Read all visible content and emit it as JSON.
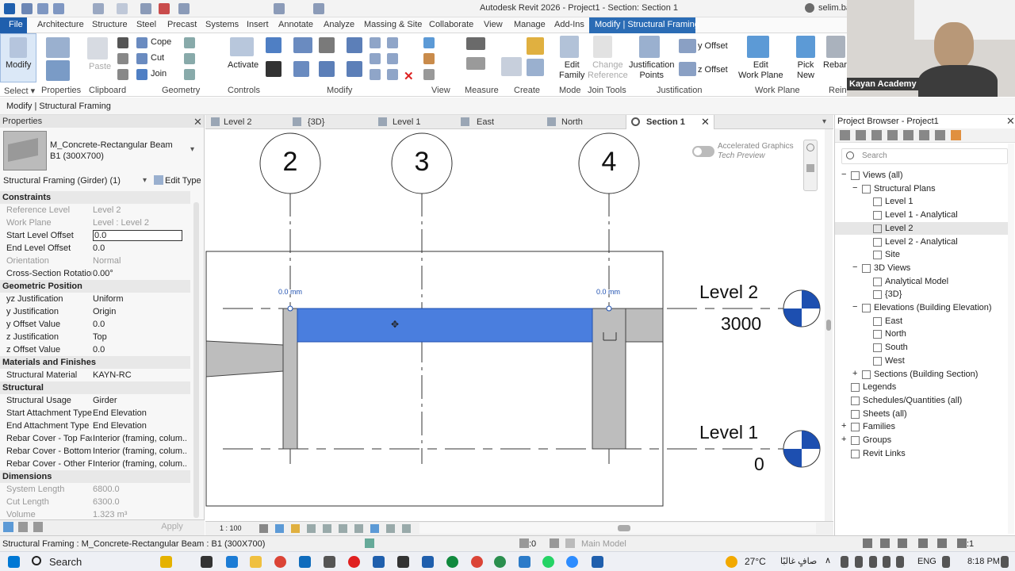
{
  "title": "Autodesk Revit 2026 - Project1 - Section: Section 1",
  "user": "selim.ba",
  "tabs": [
    "File",
    "Architecture",
    "Structure",
    "Steel",
    "Precast",
    "Systems",
    "Insert",
    "Annotate",
    "Analyze",
    "Massing & Site",
    "Collaborate",
    "View",
    "Manage",
    "Add-Ins",
    "Modify | Structural Framing"
  ],
  "ribbon": {
    "modify": "Modify",
    "paste": "Paste",
    "cope": "Cope",
    "cut": "Cut",
    "join": "Join",
    "activate": "Activate",
    "edit_family": "Edit\nFamily",
    "change_reference": "Change\nReference",
    "justification_points": "Justification\nPoints",
    "y_offset": "y Offset",
    "z_offset": "z Offset",
    "edit_work_plane": "Edit\nWork Plane",
    "pick_new": "Pick\nNew",
    "rebar": "Rebar",
    "panels": [
      "Select",
      "Properties",
      "Clipboard",
      "Geometry",
      "Controls",
      "Modify",
      "View",
      "Measure",
      "Create",
      "Mode",
      "Join Tools",
      "Justification",
      "Work Plane",
      "Rein"
    ]
  },
  "webcam_label": "Kayan Academy",
  "option_bar": "Modify | Structural Framing",
  "properties": {
    "title": "Properties",
    "family": "M_Concrete-Rectangular Beam",
    "type": "B1 (300X700)",
    "selector": "Structural Framing (Girder) (1)",
    "edit_type": "Edit Type",
    "sections": [
      {
        "name": "Constraints",
        "rows": [
          [
            "Reference Level",
            "Level 2",
            true
          ],
          [
            "Work Plane",
            "Level : Level 2",
            true
          ],
          [
            "Start Level Offset",
            "0.0",
            false
          ],
          [
            "End Level Offset",
            "0.0",
            false
          ],
          [
            "Orientation",
            "Normal",
            true
          ],
          [
            "Cross-Section Rotation",
            "0.00°",
            false
          ]
        ]
      },
      {
        "name": "Geometric Position",
        "rows": [
          [
            "yz Justification",
            "Uniform",
            false
          ],
          [
            "y Justification",
            "Origin",
            false
          ],
          [
            "y Offset Value",
            "0.0",
            false
          ],
          [
            "z Justification",
            "Top",
            false
          ],
          [
            "z Offset Value",
            "0.0",
            false
          ]
        ]
      },
      {
        "name": "Materials and Finishes",
        "rows": [
          [
            "Structural Material",
            "KAYN-RC",
            false
          ]
        ]
      },
      {
        "name": "Structural",
        "rows": [
          [
            "Structural Usage",
            "Girder",
            false
          ],
          [
            "Start Attachment Type",
            "End Elevation",
            false
          ],
          [
            "End Attachment Type",
            "End Elevation",
            false
          ],
          [
            "Rebar Cover - Top Face",
            "Interior (framing, colum...",
            false
          ],
          [
            "Rebar Cover - Bottom ...",
            "Interior (framing, colum...",
            false
          ],
          [
            "Rebar Cover - Other Fa...",
            "Interior (framing, colum...",
            false
          ]
        ]
      },
      {
        "name": "Dimensions",
        "rows": [
          [
            "System Length",
            "6800.0",
            true
          ],
          [
            "Cut Length",
            "6300.0",
            true
          ],
          [
            "Volume",
            "1.323 m³",
            true
          ]
        ]
      }
    ],
    "apply": "Apply"
  },
  "view_tabs": [
    "Level 2",
    "{3D}",
    "Level 1",
    "East",
    "North",
    "Section 1"
  ],
  "canvas": {
    "grids": [
      "2",
      "3",
      "4"
    ],
    "levels": [
      {
        "name": "Level 2",
        "elev": "3000"
      },
      {
        "name": "Level 1",
        "elev": "0"
      }
    ],
    "dim_left": "0.0 mm",
    "dim_right": "0.0 mm",
    "accel1": "Accelerated Graphics",
    "accel2": "Tech Preview",
    "scale": "1 : 100"
  },
  "browser": {
    "title": "Project Browser - Project1",
    "search": "Search",
    "nodes": [
      {
        "t": "Views (all)",
        "d": 0,
        "x": "−"
      },
      {
        "t": "Structural Plans",
        "d": 1,
        "x": "−"
      },
      {
        "t": "Level 1",
        "d": 2,
        "x": ""
      },
      {
        "t": "Level 1 - Analytical",
        "d": 2,
        "x": ""
      },
      {
        "t": "Level 2",
        "d": 2,
        "x": "",
        "sel": true
      },
      {
        "t": "Level 2 - Analytical",
        "d": 2,
        "x": ""
      },
      {
        "t": "Site",
        "d": 2,
        "x": ""
      },
      {
        "t": "3D Views",
        "d": 1,
        "x": "−"
      },
      {
        "t": "Analytical Model",
        "d": 2,
        "x": ""
      },
      {
        "t": "{3D}",
        "d": 2,
        "x": ""
      },
      {
        "t": "Elevations (Building Elevation)",
        "d": 1,
        "x": "−"
      },
      {
        "t": "East",
        "d": 2,
        "x": ""
      },
      {
        "t": "North",
        "d": 2,
        "x": ""
      },
      {
        "t": "South",
        "d": 2,
        "x": ""
      },
      {
        "t": "West",
        "d": 2,
        "x": ""
      },
      {
        "t": "Sections (Building Section)",
        "d": 1,
        "x": "+"
      },
      {
        "t": "Legends",
        "d": 0,
        "x": ""
      },
      {
        "t": "Schedules/Quantities (all)",
        "d": 0,
        "x": ""
      },
      {
        "t": "Sheets (all)",
        "d": 0,
        "x": ""
      },
      {
        "t": "Families",
        "d": 0,
        "x": "+"
      },
      {
        "t": "Groups",
        "d": 0,
        "x": "+"
      },
      {
        "t": "Revit Links",
        "d": 0,
        "x": ""
      }
    ]
  },
  "status": {
    "text": "Structural Framing : M_Concrete-Rectangular Beam : B1 (300X700)",
    "zero": ":0",
    "model": "Main Model",
    "filter": ":1"
  },
  "taskbar": {
    "search": "Search",
    "weather": "27°C",
    "weather_text": "صافٍ غالبًا",
    "lang": "ENG",
    "time": "8:18 PM"
  }
}
